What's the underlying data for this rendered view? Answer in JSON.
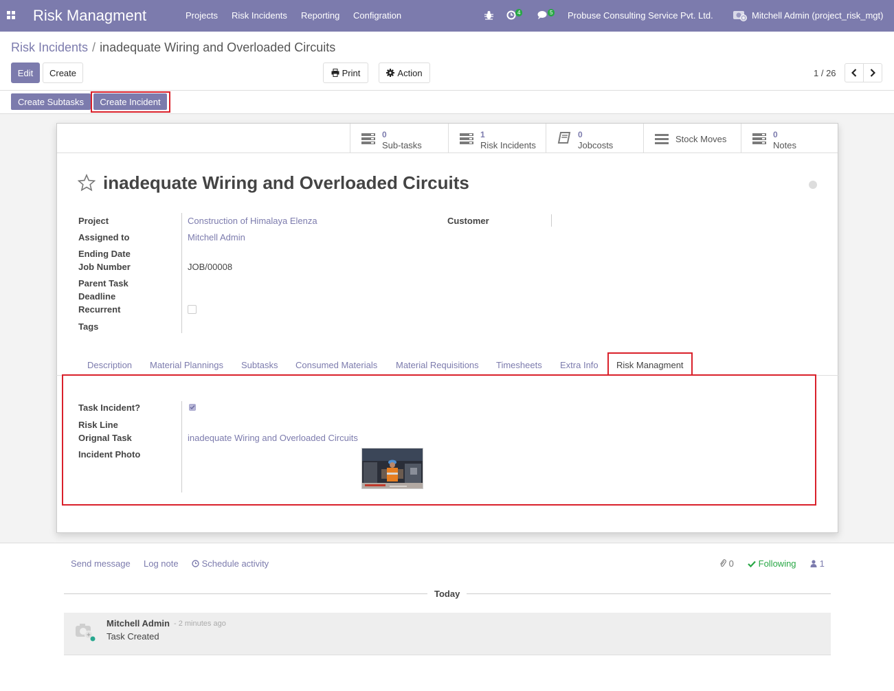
{
  "navbar": {
    "app_title": "Risk Managment",
    "menu": [
      "Projects",
      "Risk Incidents",
      "Reporting",
      "Configration"
    ],
    "activity_badge": "4",
    "message_badge": "5",
    "company": "Probuse Consulting Service Pvt. Ltd.",
    "user": "Mitchell Admin (project_risk_mgt)"
  },
  "breadcrumb": {
    "parent": "Risk Incidents",
    "separator": "/",
    "current": "inadequate Wiring and Overloaded Circuits"
  },
  "toolbar": {
    "edit": "Edit",
    "create": "Create",
    "print": "Print",
    "action": "Action",
    "pager": "1 / 26"
  },
  "status_bar": {
    "create_subtasks": "Create Subtasks",
    "create_incident": "Create Incident"
  },
  "smart_buttons": [
    {
      "count": "0",
      "label": "Sub-tasks",
      "icon": "stack-icon"
    },
    {
      "count": "1",
      "label": "Risk Incidents",
      "icon": "stack-icon"
    },
    {
      "count": "0",
      "label": "Jobcosts",
      "icon": "book-icon"
    },
    {
      "count": "",
      "label": "Stock Moves",
      "icon": "bars-icon"
    },
    {
      "count": "0",
      "label": "Notes",
      "icon": "stack-icon"
    }
  ],
  "record": {
    "title": "inadequate Wiring and Overloaded Circuits",
    "fields_left": [
      {
        "label": "Project",
        "value": "Construction of Himalaya Elenza"
      },
      {
        "label": "Assigned to",
        "value": "Mitchell Admin"
      },
      {
        "label": "Ending Date",
        "value": ""
      },
      {
        "label": "Job Number",
        "value": "JOB/00008"
      },
      {
        "label": "Parent Task",
        "value": ""
      },
      {
        "label": "Deadline",
        "value": ""
      },
      {
        "label": "Recurrent",
        "value": "unchecked"
      },
      {
        "label": "Tags",
        "value": ""
      }
    ],
    "customer_label": "Customer"
  },
  "tabs": [
    "Description",
    "Material Plannings",
    "Subtasks",
    "Consumed Materials",
    "Material Requisitions",
    "Timesheets",
    "Extra Info",
    "Risk Managment"
  ],
  "risk_tab": {
    "task_incident_label": "Task Incident?",
    "task_incident_checked": true,
    "risk_line_label": "Risk Line",
    "orignal_task_label": "Orignal Task",
    "orignal_task_value": "inadequate Wiring and Overloaded Circuits",
    "incident_photo_label": "Incident Photo"
  },
  "chatter": {
    "send_message": "Send message",
    "log_note": "Log note",
    "schedule_activity": "Schedule activity",
    "attachments": "0",
    "following": "Following",
    "followers": "1",
    "today": "Today",
    "message": {
      "author": "Mitchell Admin",
      "time": "- 2 minutes ago",
      "body": "Task Created"
    }
  },
  "colors": {
    "brand": "#7c7bad",
    "highlight": "#d9202a",
    "following": "#28a745"
  }
}
